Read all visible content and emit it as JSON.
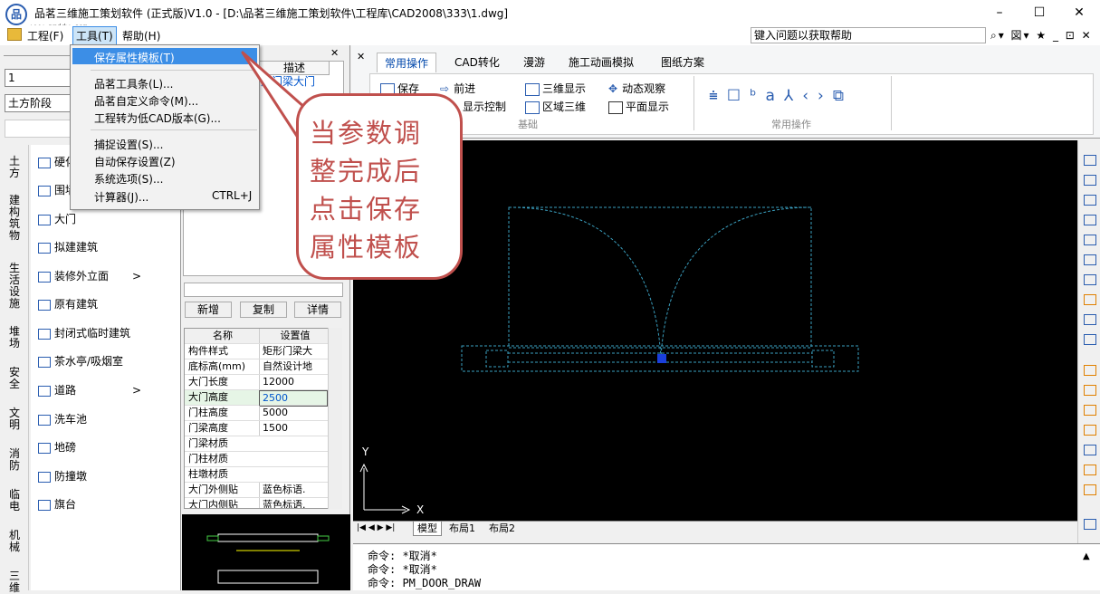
{
  "window": {
    "title": "品茗三维施工策划软件 (正式版)V1.0 - [D:\\品茗三维施工策划软件\\工程库\\CAD2008\\333\\1.dwg]",
    "watermark": "www.pmddw.com",
    "logo": "品",
    "min": "–",
    "max": "☐",
    "close": "✕"
  },
  "menu": {
    "items": [
      "工程(F)",
      "工具(T)",
      "帮助(H)"
    ],
    "help_placeholder": "键入问题以获取帮助",
    "help_tools": "⌕▾ 図▾ ★ _ ⊡ ✕"
  },
  "dropdown": {
    "items": [
      {
        "label": "保存属性模板(T)",
        "shortcut": ""
      },
      {
        "label": "品茗工具条(L)...",
        "shortcut": ""
      },
      {
        "label": "品茗自定义命令(M)...",
        "shortcut": ""
      },
      {
        "label": "工程转为低CAD版本(G)...",
        "shortcut": ""
      },
      {
        "label": "捕捉设置(S)...",
        "shortcut": ""
      },
      {
        "label": "自动保存设置(Z)",
        "shortcut": ""
      },
      {
        "label": "系统选项(S)...",
        "shortcut": ""
      },
      {
        "label": "计算器(J)...",
        "shortcut": "CTRL+J"
      }
    ]
  },
  "left": {
    "combo1": "1",
    "combo2": "土方阶段",
    "vtabs": [
      "土方",
      "建构筑物",
      "生活设施",
      "堆场",
      "安全",
      "文明",
      "消防",
      "临电",
      "机械",
      "三维"
    ],
    "categories": [
      {
        "label": "硬化",
        "arrow": ""
      },
      {
        "label": "围墙",
        "arrow": ""
      },
      {
        "label": "大门",
        "arrow": ""
      },
      {
        "label": "拟建建筑",
        "arrow": ""
      },
      {
        "label": "装修外立面",
        "arrow": ">"
      },
      {
        "label": "原有建筑",
        "arrow": ""
      },
      {
        "label": "封闭式临时建筑",
        "arrow": ""
      },
      {
        "label": "茶水亭/吸烟室",
        "arrow": ""
      },
      {
        "label": "道路",
        "arrow": ">"
      },
      {
        "label": "洗车池",
        "arrow": ""
      },
      {
        "label": "地磅",
        "arrow": ""
      },
      {
        "label": "防撞墩",
        "arrow": ""
      },
      {
        "label": "旗台",
        "arrow": ""
      }
    ]
  },
  "middle": {
    "table_header": "描述",
    "table_cell": "形门梁大门",
    "buttons": [
      "新增",
      "复制",
      "详情"
    ],
    "props_header": {
      "name": "名称",
      "value": "设置值"
    },
    "props": [
      {
        "k": "构件样式",
        "v": "矩形门梁大"
      },
      {
        "k": "底标高(mm)",
        "v": "自然设计地"
      },
      {
        "k": "大门长度",
        "v": "12000"
      },
      {
        "k": "大门高度",
        "v": "2500"
      },
      {
        "k": "门柱高度",
        "v": "5000"
      },
      {
        "k": "门梁高度",
        "v": "1500"
      },
      {
        "k": "门梁材质",
        "v": ""
      },
      {
        "k": "门柱材质",
        "v": ""
      },
      {
        "k": "柱墩材质",
        "v": ""
      },
      {
        "k": "大门外侧贴",
        "v": "蓝色标语."
      },
      {
        "k": "大门内侧贴",
        "v": "蓝色标语."
      }
    ]
  },
  "ribbon": {
    "tabs": [
      "常用操作",
      "CAD转化",
      "漫游",
      "施工动画模拟",
      "图纸方案"
    ],
    "buttons": [
      "保存",
      "前进",
      "显示控制",
      "三维显示",
      "区域三维",
      "动态观察",
      "平面显示"
    ],
    "groups": [
      "基础",
      "常用操作"
    ]
  },
  "canvas": {
    "axis_y": "Y",
    "axis_x": "X",
    "layout_tabs": [
      "模型",
      "布局1",
      "布局2"
    ],
    "layout_nav": "|◀ ◀ ▶ ▶|"
  },
  "command": {
    "lines": [
      "命令: *取消*",
      "命令: *取消*",
      "命令: PM_DOOR_DRAW"
    ]
  },
  "callout": {
    "lines": [
      "当参数调",
      "整完成后",
      "点击保存",
      "属性模板"
    ]
  },
  "colors": {
    "accent": "#3c8ee6",
    "callout": "#c0504d",
    "drawing": "#3a9fbf"
  }
}
